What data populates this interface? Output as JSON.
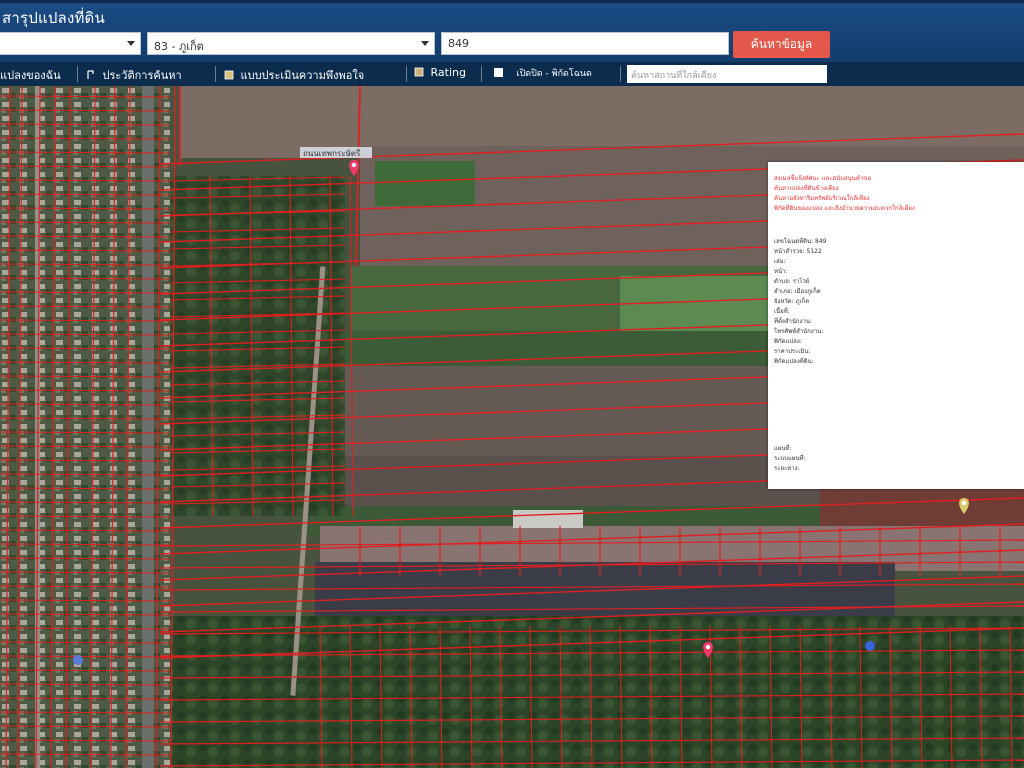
{
  "header": {
    "title": "สารุปแปลงที่ดิน",
    "province_select": "",
    "district_select": "83 - ภูเก็ต",
    "parcel_input": "849",
    "search_button": "ค้นหาข้อมูล"
  },
  "toolbar": {
    "items": [
      {
        "label": "แปลงของฉัน",
        "icon": "map-icon"
      },
      {
        "label": "ประวัติการค้นหา",
        "icon": "history-icon"
      },
      {
        "label": "แบบประเมินความพึงพอใจ",
        "icon": "form-icon"
      },
      {
        "label": "Rating",
        "icon": "star-icon"
      },
      {
        "label": "เปิดปิด - พิกัดโฉนด",
        "icon": "checkbox"
      }
    ],
    "search_placeholder": "ค้นหาสถานที่ใกล้เคียง"
  },
  "map": {
    "road_label": "ถนนเทพกระษัตรี",
    "accent_color": "#e02020",
    "marker_color": "#ec3b6a"
  },
  "popup": {
    "header_lines": [
      "ส่งเมลชี้แจ้งทัศนะ และสนับสนุนคำขอ",
      "ค้นหาแปลงที่ดินข้างเคียง",
      "ค้นหาอสังหาริมทรัพย์บริเวณใกล้เคียง",
      "พิกัดที่ดินของแปลง และสิ่งอำนวยความสะดวกใกล้เคียง"
    ],
    "fields": [
      {
        "label": "เลขโฉนดที่ดิน:",
        "value": "849",
        "link": false
      },
      {
        "label": "หน้าสำรวจ:",
        "value": "5122",
        "link": false
      },
      {
        "label": "เล่ม:",
        "value": "",
        "link": false
      },
      {
        "label": "หน้า:",
        "value": "",
        "link": false
      },
      {
        "label": "ตำบล:",
        "value": "ราไวย์",
        "link": false
      },
      {
        "label": "อำเภอ:",
        "value": "เมืองภูเก็ต",
        "link": false
      },
      {
        "label": "จังหวัด:",
        "value": "ภูเก็ต",
        "link": false
      },
      {
        "label": "เนื้อที่:",
        "value": "",
        "link": false
      },
      {
        "label": "ที่ตั้งสำนักงาน:",
        "value": "",
        "link": false
      },
      {
        "label": "โทรศัพท์สำนักงาน:",
        "value": "",
        "link": false
      },
      {
        "label": "พิกัดแปลง:",
        "value": "",
        "link": true
      },
      {
        "label": "ราคาประเมิน:",
        "value": "",
        "link": false
      },
      {
        "label": "พิกัดแปลงที่ดิน:",
        "value": "",
        "link": true
      }
    ],
    "footer_lines": [
      {
        "label": "แผนที่:",
        "value": "",
        "link": true
      },
      {
        "label": "ระบบแผนที่:",
        "value": "",
        "link": true
      },
      {
        "label": "ระยะห่าง:",
        "value": "",
        "link": false
      }
    ]
  }
}
